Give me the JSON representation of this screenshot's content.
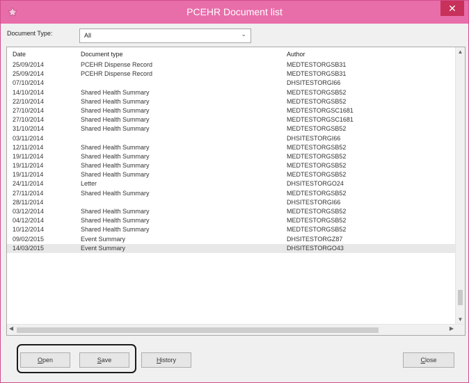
{
  "window": {
    "title": "PCEHR Document list",
    "close_label": "✕"
  },
  "filter": {
    "label": "Document Type:",
    "value": "All"
  },
  "table": {
    "headers": [
      "Date",
      "Document type",
      "Author"
    ],
    "rows": [
      [
        "25/09/2014",
        "PCEHR Dispense Record",
        "MEDTESTORGSB31"
      ],
      [
        "25/09/2014",
        "PCEHR Dispense Record",
        "MEDTESTORGSB31"
      ],
      [
        "07/10/2014",
        "",
        "DHSITESTORGI66"
      ],
      [
        "14/10/2014",
        "Shared Health Summary",
        "MEDTESTORGSB52"
      ],
      [
        "22/10/2014",
        "Shared Health Summary",
        "MEDTESTORGSB52"
      ],
      [
        "27/10/2014",
        "Shared Health Summary",
        "MEDTESTORGSC1681"
      ],
      [
        "27/10/2014",
        "Shared Health Summary",
        "MEDTESTORGSC1681"
      ],
      [
        "31/10/2014",
        "Shared Health Summary",
        "MEDTESTORGSB52"
      ],
      [
        "03/11/2014",
        "",
        "DHSITESTORGI66"
      ],
      [
        "12/11/2014",
        "Shared Health Summary",
        "MEDTESTORGSB52"
      ],
      [
        "19/11/2014",
        "Shared Health Summary",
        "MEDTESTORGSB52"
      ],
      [
        "19/11/2014",
        "Shared Health Summary",
        "MEDTESTORGSB52"
      ],
      [
        "19/11/2014",
        "Shared Health Summary",
        "MEDTESTORGSB52"
      ],
      [
        "24/11/2014",
        "Letter",
        "DHSITESTORGO24"
      ],
      [
        "27/11/2014",
        "Shared Health Summary",
        "MEDTESTORGSB52"
      ],
      [
        "28/11/2014",
        "",
        "DHSITESTORGI66"
      ],
      [
        "03/12/2014",
        "Shared Health Summary",
        "MEDTESTORGSB52"
      ],
      [
        "04/12/2014",
        "Shared Health Summary",
        "MEDTESTORGSB52"
      ],
      [
        "10/12/2014",
        "Shared Health Summary",
        "MEDTESTORGSB52"
      ],
      [
        "09/02/2015",
        "Event Summary",
        "DHSITESTORGZ87"
      ],
      [
        "14/03/2015",
        "Event Summary",
        "DHSITESTORGO43"
      ]
    ],
    "selected_row": 20
  },
  "buttons": {
    "open": {
      "first": "O",
      "rest": "pen"
    },
    "save": {
      "first": "S",
      "rest": "ave"
    },
    "history": {
      "first": "H",
      "rest": "istory"
    },
    "close": {
      "first": "C",
      "rest": "lose"
    }
  }
}
